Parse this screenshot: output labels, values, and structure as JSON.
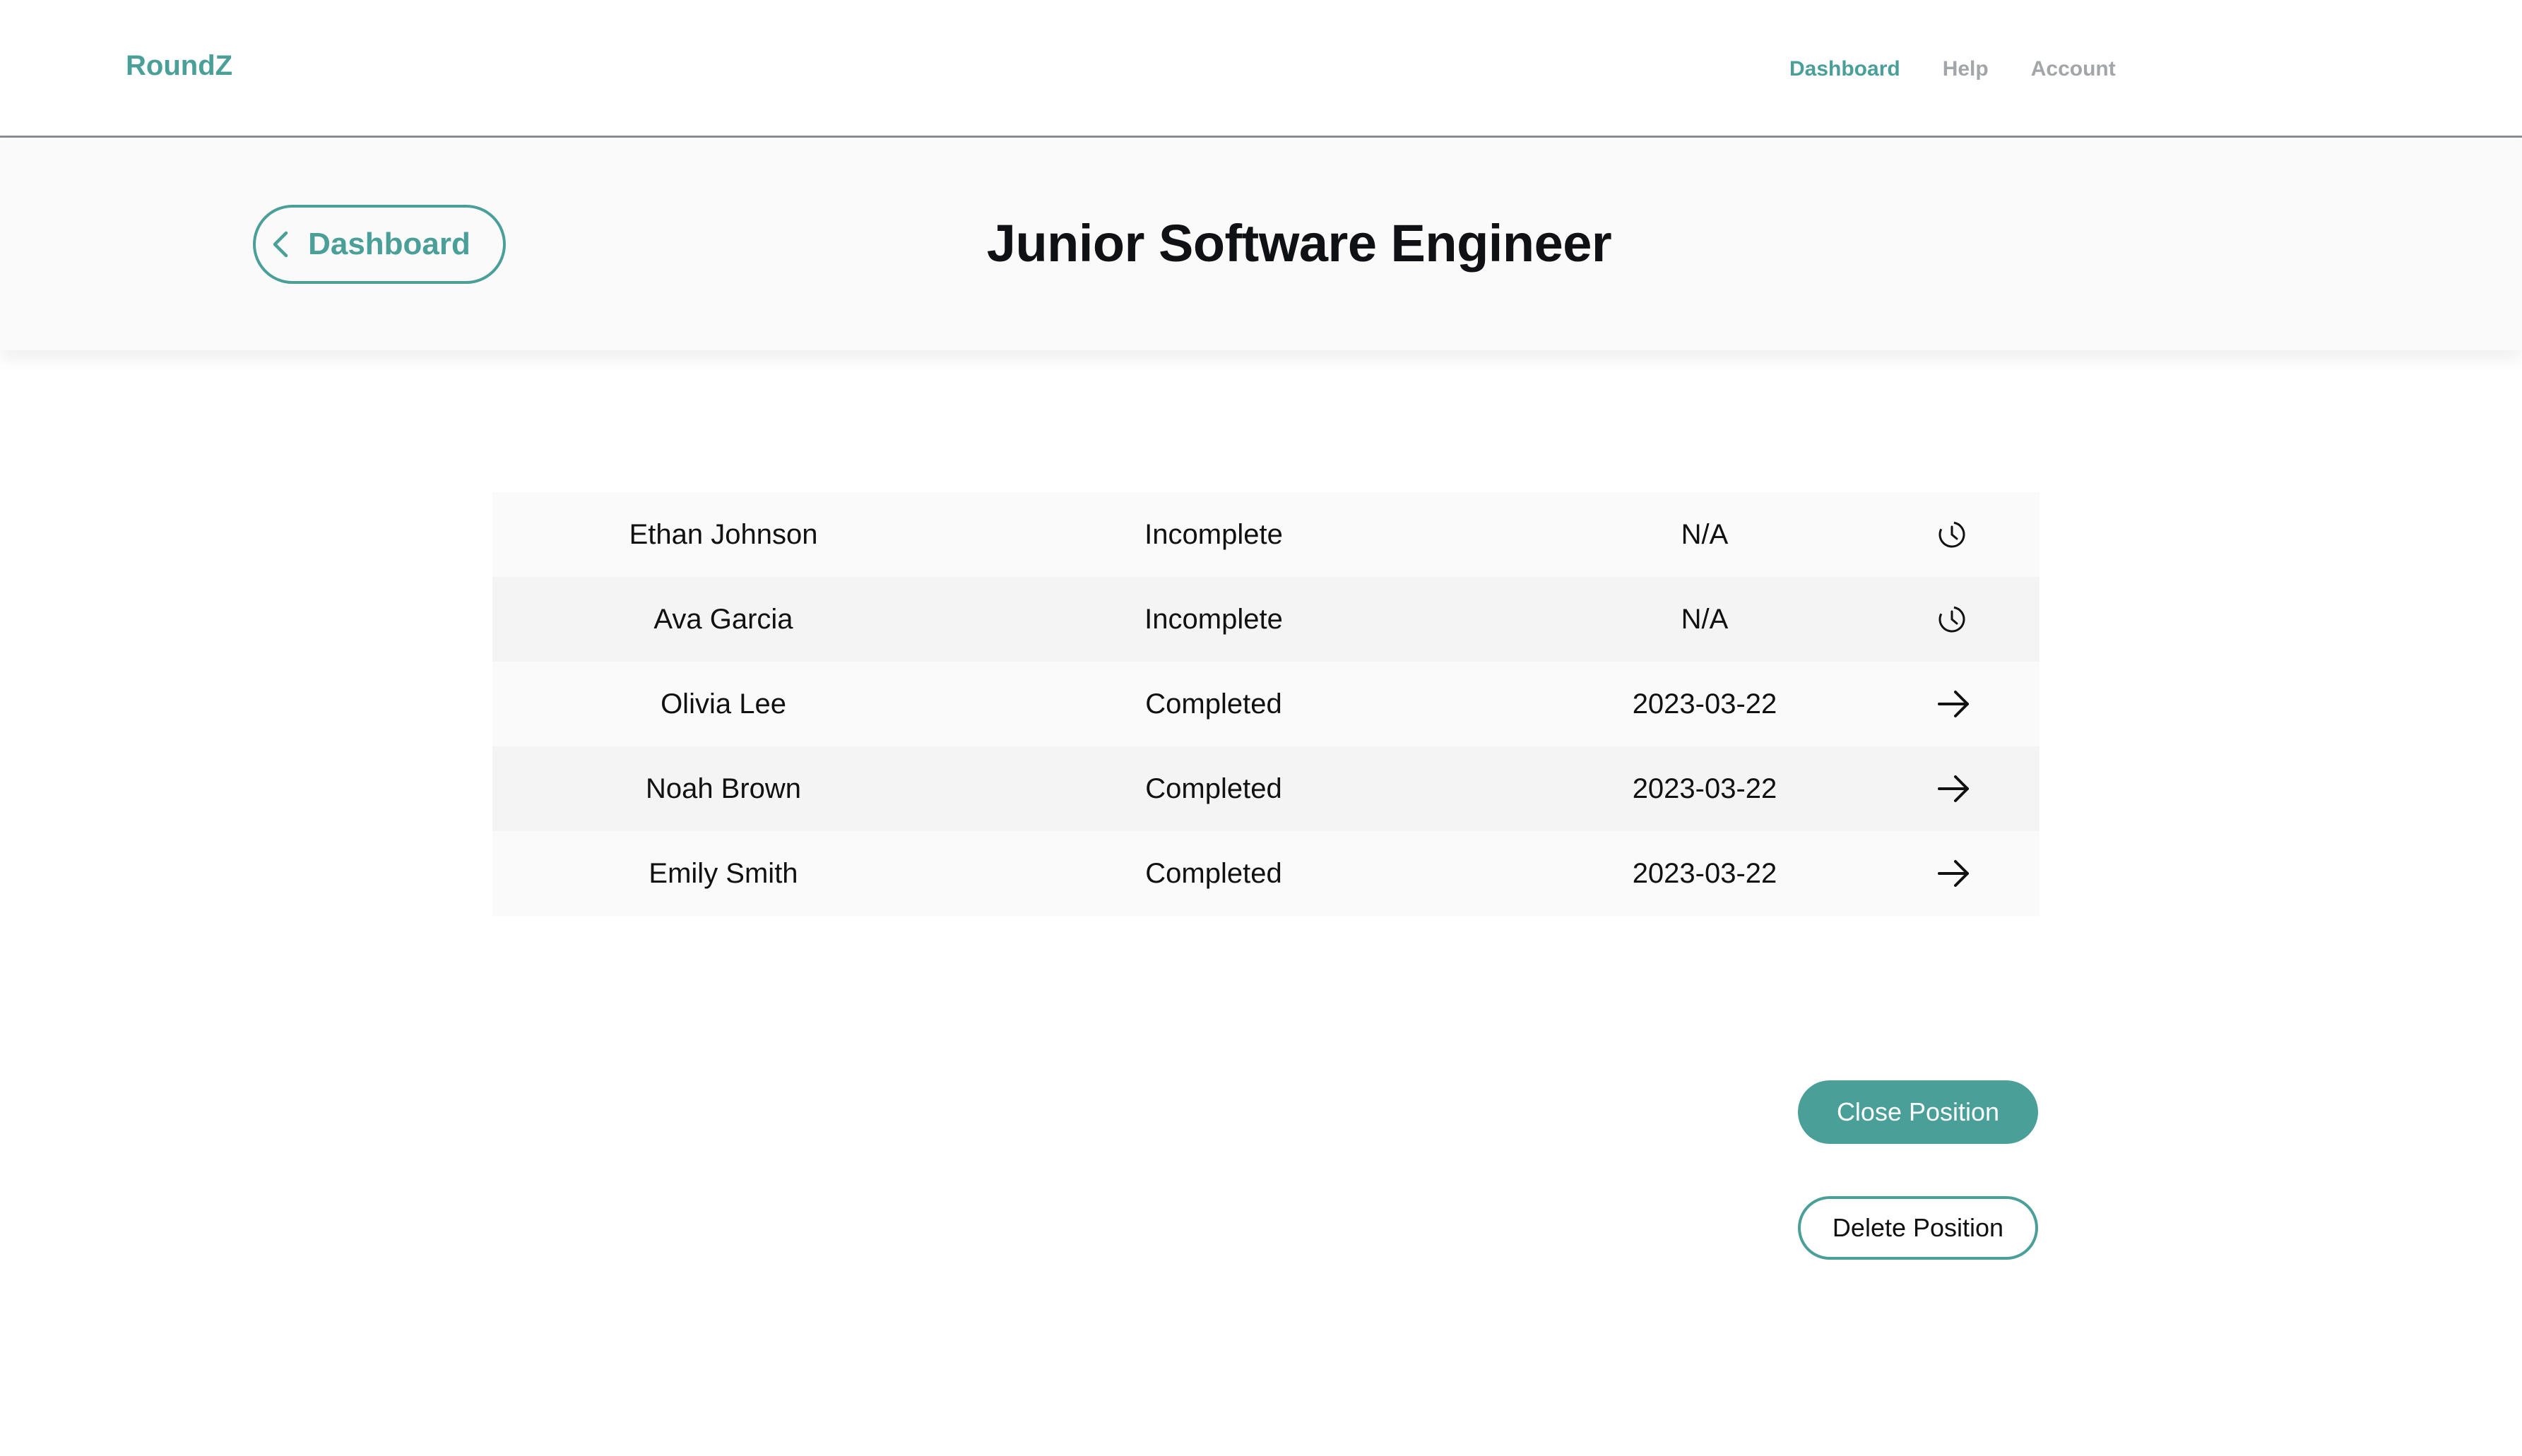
{
  "nav": {
    "brand": "RoundZ",
    "links": [
      {
        "label": "Dashboard",
        "active": true
      },
      {
        "label": "Help",
        "active": false
      },
      {
        "label": "Account",
        "active": false
      }
    ]
  },
  "header": {
    "back_label": "Dashboard",
    "back_icon": "chevron-left-icon",
    "title": "Junior Software Engineer"
  },
  "candidates": [
    {
      "name": "Ethan Johnson",
      "status": "Incomplete",
      "date": "N/A",
      "icon": "clock-icon"
    },
    {
      "name": "Ava Garcia",
      "status": "Incomplete",
      "date": "N/A",
      "icon": "clock-icon"
    },
    {
      "name": "Olivia Lee",
      "status": "Completed",
      "date": "2023-03-22",
      "icon": "arrow-right-icon"
    },
    {
      "name": "Noah Brown",
      "status": "Completed",
      "date": "2023-03-22",
      "icon": "arrow-right-icon"
    },
    {
      "name": "Emily Smith",
      "status": "Completed",
      "date": "2023-03-22",
      "icon": "arrow-right-icon"
    }
  ],
  "actions": {
    "close_label": "Close Position",
    "delete_label": "Delete Position"
  },
  "colors": {
    "accent": "#4a9f98",
    "nav_inactive": "#a3a6a8",
    "header_band": "#fafafa",
    "row_odd": "#fafafa",
    "row_even": "#f4f4f4"
  }
}
